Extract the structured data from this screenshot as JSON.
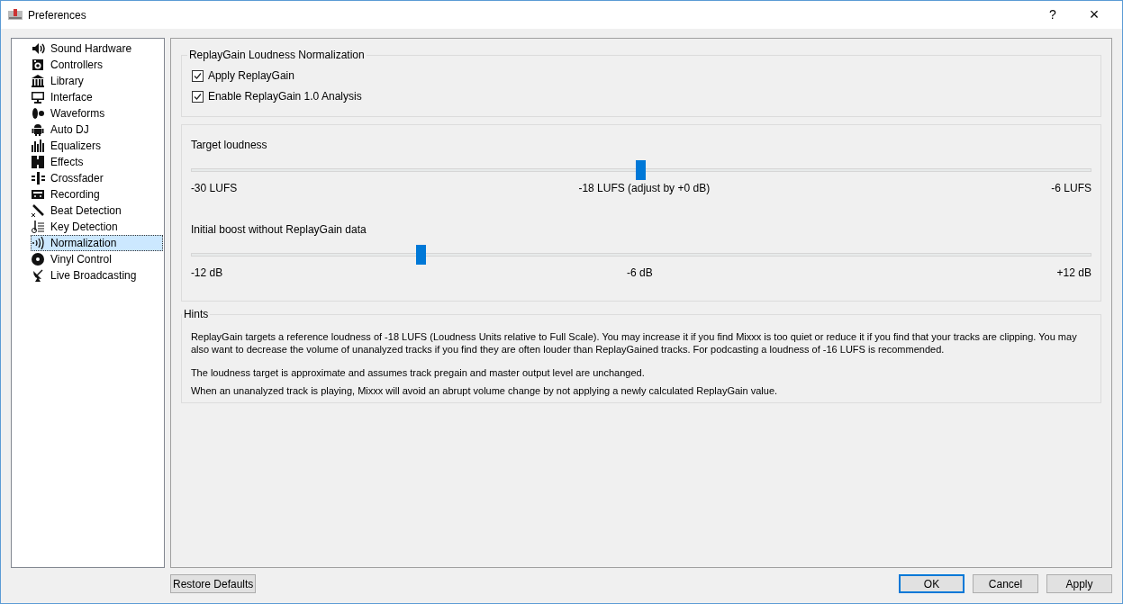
{
  "window": {
    "title": "Preferences",
    "help": "?",
    "close": "×"
  },
  "sidebar": {
    "items": [
      {
        "label": "Sound Hardware",
        "selected": false
      },
      {
        "label": "Controllers",
        "selected": false
      },
      {
        "label": "Library",
        "selected": false
      },
      {
        "label": "Interface",
        "selected": false
      },
      {
        "label": "Waveforms",
        "selected": false
      },
      {
        "label": "Auto DJ",
        "selected": false
      },
      {
        "label": "Equalizers",
        "selected": false
      },
      {
        "label": "Effects",
        "selected": false
      },
      {
        "label": "Crossfader",
        "selected": false
      },
      {
        "label": "Recording",
        "selected": false
      },
      {
        "label": "Beat Detection",
        "selected": false
      },
      {
        "label": "Key Detection",
        "selected": false
      },
      {
        "label": "Normalization",
        "selected": true
      },
      {
        "label": "Vinyl Control",
        "selected": false
      },
      {
        "label": "Live Broadcasting",
        "selected": false
      }
    ]
  },
  "replaygain": {
    "title": "ReplayGain Loudness Normalization",
    "options": [
      {
        "label": "Apply ReplayGain",
        "checked": true
      },
      {
        "label": "Enable ReplayGain 1.0 Analysis",
        "checked": true
      }
    ]
  },
  "sliders": [
    {
      "label": "Target loudness",
      "level": 0.5,
      "min": "-30 LUFS",
      "mid": "-18 LUFS (adjust by +0 dB)",
      "max": "-6 LUFS"
    },
    {
      "label": "Initial boost without ReplayGain data",
      "level": 0.253,
      "min": "-12 dB",
      "mid": "-6 dB",
      "max": "+12 dB"
    }
  ],
  "hints": {
    "title": "Hints",
    "paragraphs": [
      "ReplayGain targets a reference loudness of -18 LUFS (Loudness Units relative to Full Scale). You may increase it if you find Mixxx is too quiet or reduce it if you find that your tracks are clipping. You may also want to decrease the volume of unanalyzed tracks if you find they are often louder than ReplayGained tracks. For podcasting a loudness of -16 LUFS is recommended.",
      "The loudness target is approximate and assumes track pregain and master output level are unchanged.",
      "When an unanalyzed track is playing, Mixxx will avoid an abrupt volume change by not applying a newly calculated ReplayGain value."
    ]
  },
  "buttons": {
    "restore": "Restore Defaults",
    "actions": [
      {
        "label": "OK",
        "selected": true
      },
      {
        "label": "Cancel",
        "selected": false
      },
      {
        "label": "Apply",
        "selected": false
      }
    ]
  }
}
